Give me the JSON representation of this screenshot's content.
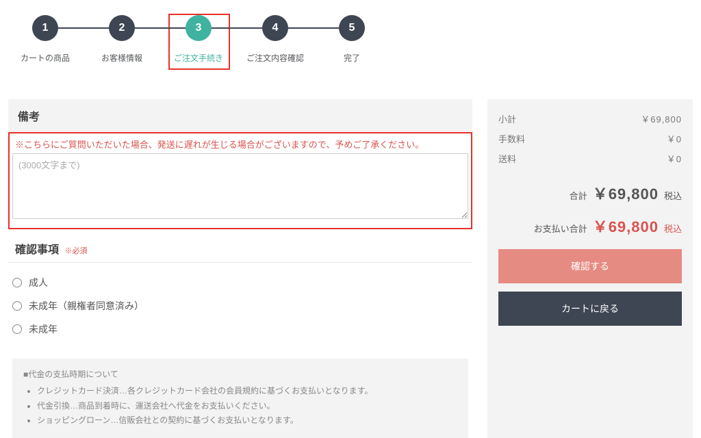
{
  "steps": [
    {
      "num": "1",
      "label": "カートの商品"
    },
    {
      "num": "2",
      "label": "お客様情報"
    },
    {
      "num": "3",
      "label": "ご注文手続き"
    },
    {
      "num": "4",
      "label": "ご注文内容確認"
    },
    {
      "num": "5",
      "label": "完了"
    }
  ],
  "remarks": {
    "heading": "備考",
    "warning": "※こちらにご質問いただいた場合、発送に遅れが生じる場合がございますので、予めご了承ください。",
    "placeholder": "(3000文字まで)"
  },
  "confirm": {
    "heading": "確認事項",
    "required": "※必須",
    "options": [
      "成人",
      "未成年（親権者同意済み）",
      "未成年"
    ]
  },
  "info": {
    "title": "■代金の支払時期について",
    "lines": [
      "クレジットカード決済…各クレジットカード会社の会員規約に基づくお支払いとなります。",
      "代金引換…商品到着時に、運送会社へ代金をお支払いください。",
      "ショッピングローン…信販会社との契約に基づくお支払いとなります。"
    ]
  },
  "summary": {
    "subtotal_label": "小計",
    "subtotal_value": "￥69,800",
    "fee_label": "手数料",
    "fee_value": "￥0",
    "shipping_label": "送料",
    "shipping_value": "￥0",
    "total_label": "合計",
    "total_value": "￥69,800",
    "tax_inc": "税込",
    "pay_label": "お支払い合計",
    "pay_value": "￥69,800",
    "confirm_btn": "確認する",
    "back_btn": "カートに戻る"
  }
}
